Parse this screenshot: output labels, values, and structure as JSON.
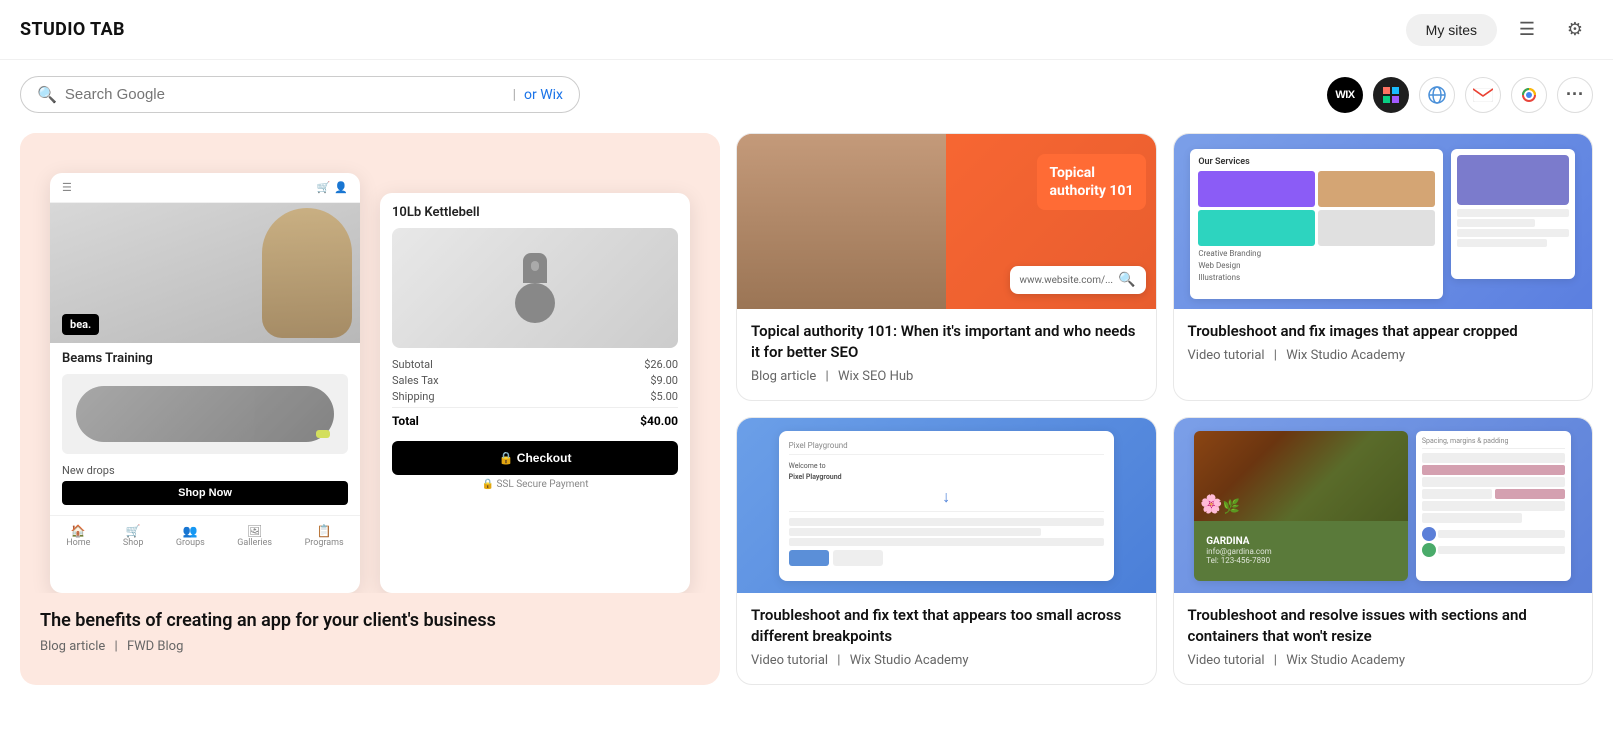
{
  "header": {
    "title": "STUDIO TAB",
    "my_sites_label": "My sites",
    "icons": [
      {
        "name": "news-icon",
        "symbol": "☰"
      },
      {
        "name": "settings-icon",
        "symbol": "⚙"
      }
    ]
  },
  "search": {
    "placeholder": "Search Google",
    "or_text": "or Wix"
  },
  "shortcuts": [
    {
      "name": "wix",
      "label": "WIX",
      "class": "shortcut-wix"
    },
    {
      "name": "figma",
      "label": "",
      "class": "shortcut-figma"
    },
    {
      "name": "dnd",
      "label": "",
      "class": "shortcut-dnd"
    },
    {
      "name": "gmail",
      "label": "",
      "class": "shortcut-gmail"
    },
    {
      "name": "analytics",
      "label": "",
      "class": "shortcut-analytics"
    },
    {
      "name": "more",
      "label": "···",
      "class": "shortcut-more"
    }
  ],
  "featured_card": {
    "title": "The benefits of creating an app for your client's business",
    "meta_type": "Blog article",
    "meta_source": "FWD Blog",
    "screen_left": {
      "logo": "bea.",
      "product_title": "Beams Training",
      "new_drops": "New drops",
      "shop_btn": "Shop Now",
      "nav_items": [
        "Home",
        "Shop",
        "Groups",
        "Galleries",
        "Programs"
      ]
    },
    "screen_right": {
      "cart_title": "10Lb Kettlebell",
      "subtotal_label": "Subtotal",
      "subtotal_value": "$26.00",
      "tax_label": "Sales Tax",
      "tax_value": "$9.00",
      "shipping_label": "Shipping",
      "shipping_value": "$5.00",
      "total_label": "Total",
      "total_value": "$40.00",
      "checkout_btn": "🔒 Checkout",
      "ssl_text": "🔒 SSL Secure Payment"
    }
  },
  "cards": [
    {
      "id": "topical-authority",
      "title": "Topical authority 101: When it's important and who needs it for better SEO",
      "meta_type": "Blog article",
      "meta_source": "Wix SEO Hub",
      "thumb_type": "seo",
      "thumb_text1": "Topical",
      "thumb_text2": "authority 101",
      "thumb_url_text": "www.website.com/..."
    },
    {
      "id": "troubleshoot-images",
      "title": "Troubleshoot and fix images that appear cropped",
      "meta_type": "Video tutorial",
      "meta_source": "Wix Studio Academy",
      "thumb_type": "images",
      "panel_title": "Our Services",
      "panel_items": [
        "Creative Branding",
        "Web Design",
        "Illustrations"
      ]
    },
    {
      "id": "troubleshoot-text",
      "title": "Troubleshoot and fix text that appears too small across different breakpoints",
      "meta_type": "Video tutorial",
      "meta_source": "Wix Studio Academy",
      "thumb_type": "text-size",
      "panel_header": "Pixel Playground",
      "panel_content": "Welcome to Pixel Playground"
    },
    {
      "id": "troubleshoot-sections",
      "title": "Troubleshoot and resolve issues with sections and containers that won't resize",
      "meta_type": "Video tutorial",
      "meta_source": "Wix Studio Academy",
      "thumb_type": "sections"
    }
  ]
}
